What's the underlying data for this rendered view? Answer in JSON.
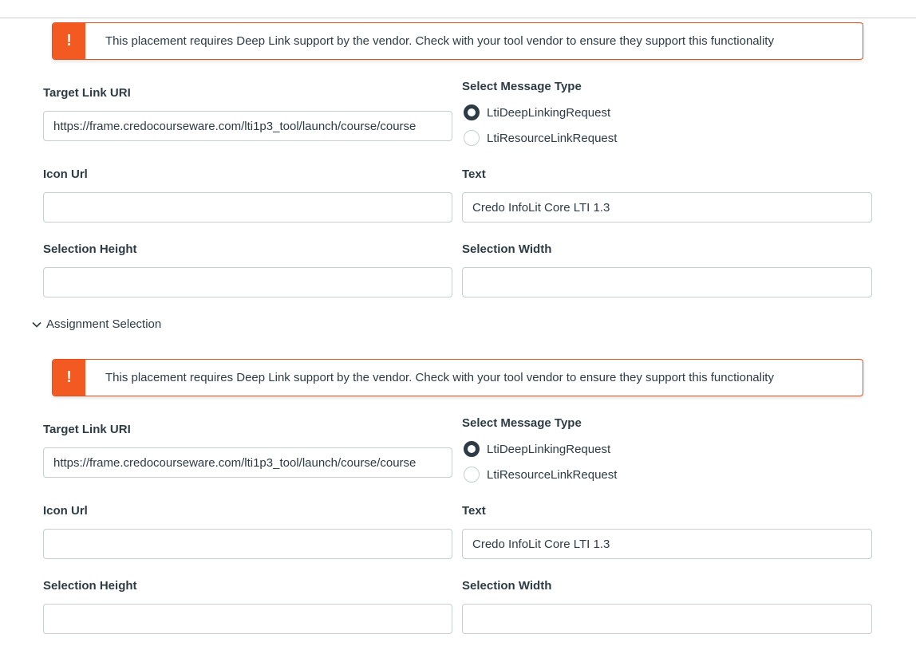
{
  "alert_text": "This placement requires Deep Link support by the vendor. Check with your tool vendor to ensure they support this functionality",
  "alert_symbol": "!",
  "placements": [
    {
      "target_link_label": "Target Link URI",
      "target_link_value": "https://frame.credocourseware.com/lti1p3_tool/launch/course/course",
      "message_type_label": "Select Message Type",
      "options": [
        "LtiDeepLinkingRequest",
        "LtiResourceLinkRequest"
      ],
      "selected_option": "LtiDeepLinkingRequest",
      "icon_url_label": "Icon Url",
      "icon_url_value": "",
      "text_label": "Text",
      "text_value": "Credo InfoLit Core LTI 1.3",
      "selection_height_label": "Selection Height",
      "selection_height_value": "",
      "selection_width_label": "Selection Width",
      "selection_width_value": ""
    },
    {
      "target_link_label": "Target Link URI",
      "target_link_value": "https://frame.credocourseware.com/lti1p3_tool/launch/course/course",
      "message_type_label": "Select Message Type",
      "options": [
        "LtiDeepLinkingRequest",
        "LtiResourceLinkRequest"
      ],
      "selected_option": "LtiDeepLinkingRequest",
      "icon_url_label": "Icon Url",
      "icon_url_value": "",
      "text_label": "Text",
      "text_value": "Credo InfoLit Core LTI 1.3",
      "selection_height_label": "Selection Height",
      "selection_height_value": "",
      "selection_width_label": "Selection Width",
      "selection_width_value": ""
    }
  ],
  "assignment_section_label": "Assignment Selection",
  "colors": {
    "alert_accent": "#f25a22",
    "alert_border": "#e0531f",
    "text": "#2d3b45",
    "input_border": "#c7cdd1"
  },
  "icons": {
    "alert": "warning-exclamation-icon",
    "section": "chevron-down-icon"
  }
}
